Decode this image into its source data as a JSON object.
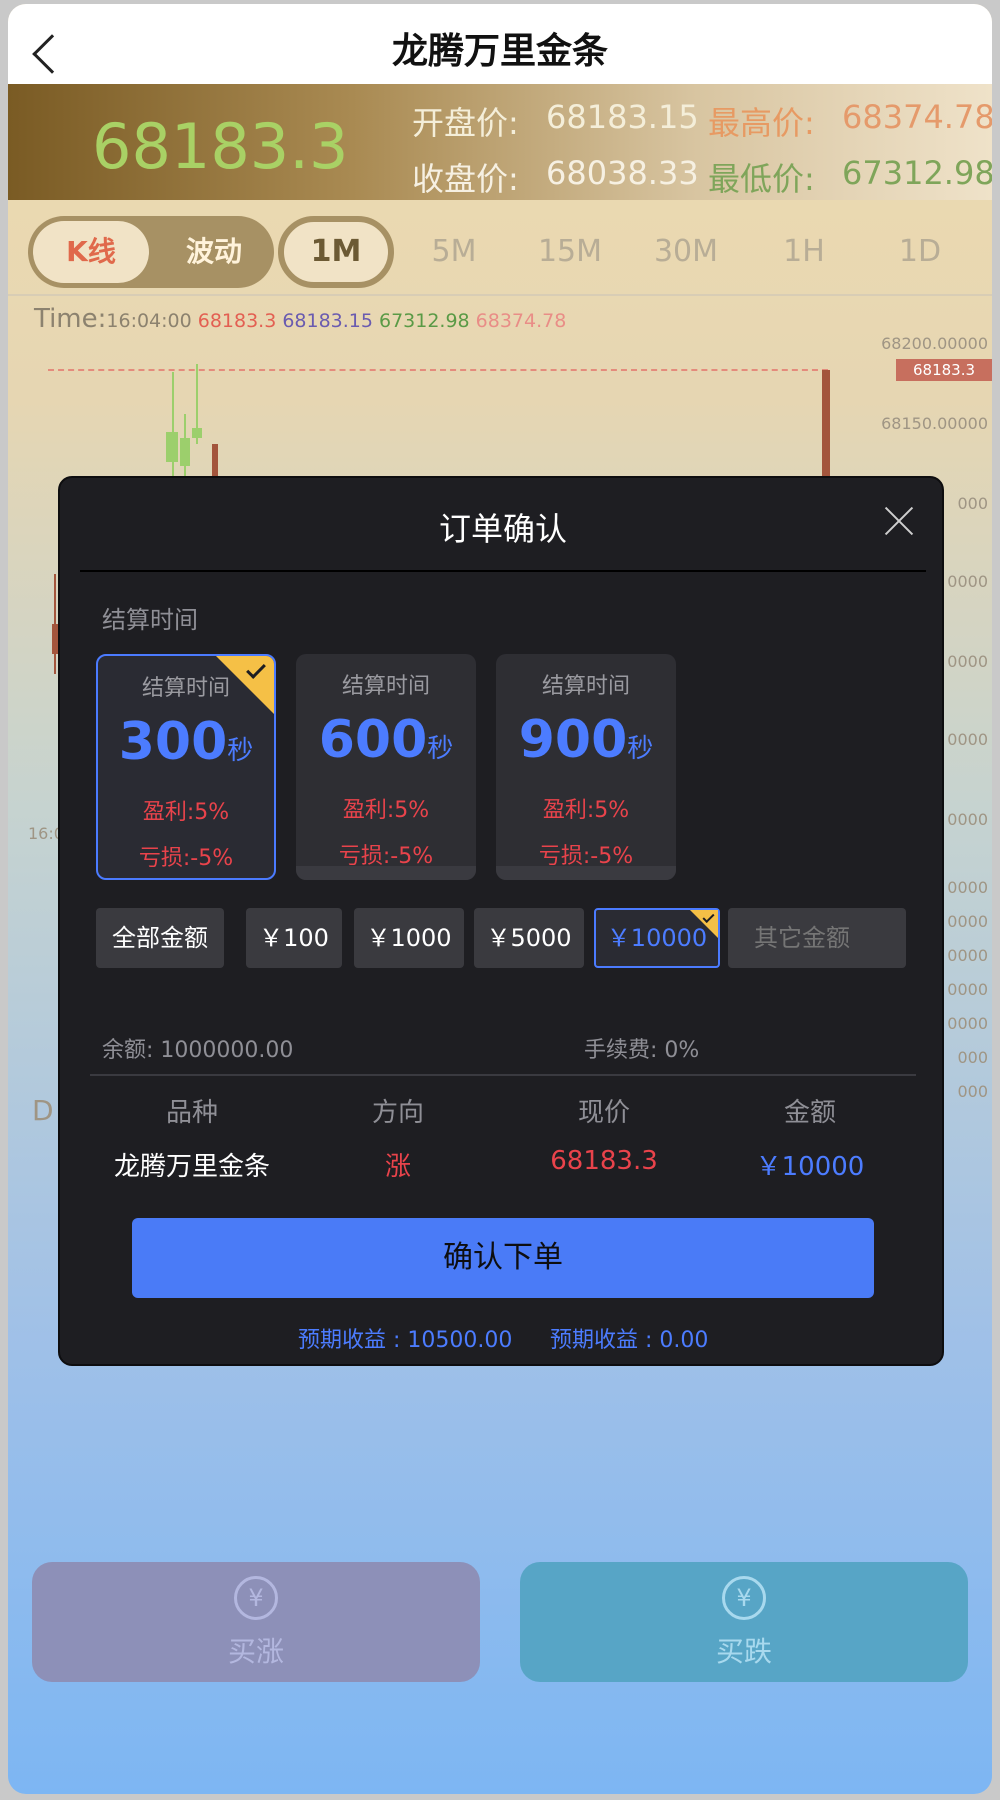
{
  "header": {
    "title": "龙腾万里金条"
  },
  "price_panel": {
    "current": "68183.3",
    "open_label": "开盘价:",
    "open_value": "68183.15",
    "high_label": "最高价:",
    "high_value": "68374.78",
    "close_label": "收盘价:",
    "close_value": "68038.33",
    "low_label": "最低价:",
    "low_value": "67312.98"
  },
  "tabs": {
    "kline": "K线",
    "wave": "波动",
    "timeframes": [
      "1M",
      "5M",
      "15M",
      "30M",
      "1H",
      "1D"
    ],
    "active_timeframe": "1M"
  },
  "chart_info": {
    "time_label": "Time:",
    "time_value": "16:04:00",
    "c": "68183.3",
    "o": "68183.15",
    "l": "67312.98",
    "h": "68374.78"
  },
  "chart_axis": {
    "y1": "68200.00000",
    "y2": "68150.00000",
    "last_price": "68183.3",
    "left_time": "16:0",
    "d_label": "D",
    "partial_labels": [
      "000",
      "0000",
      "0000",
      "0000",
      "0000",
      "0000",
      "0000",
      "0000",
      "0000",
      "0000",
      "000",
      "000",
      "0000",
      "0000"
    ]
  },
  "modal": {
    "title": "订单确认",
    "section_label": "结算时间",
    "cards": [
      {
        "head": "结算时间",
        "secs": "300",
        "unit": "秒",
        "profit": "盈利:5%",
        "loss": "亏损:-5%",
        "selected": true
      },
      {
        "head": "结算时间",
        "secs": "600",
        "unit": "秒",
        "profit": "盈利:5%",
        "loss": "亏损:-5%",
        "selected": false
      },
      {
        "head": "结算时间",
        "secs": "900",
        "unit": "秒",
        "profit": "盈利:5%",
        "loss": "亏损:-5%",
        "selected": false
      }
    ],
    "amounts": [
      "全部金额",
      "￥100",
      "￥1000",
      "￥5000",
      "￥10000"
    ],
    "selected_amount": "￥10000",
    "other_amount_placeholder": "其它金额",
    "balance": "余额: 1000000.00",
    "fee": "手续费: 0%",
    "table_headers": [
      "品种",
      "方向",
      "现价",
      "金额"
    ],
    "row": {
      "product": "龙腾万里金条",
      "direction": "涨",
      "price": "68183.3",
      "amount": "￥10000"
    },
    "confirm_label": "确认下单",
    "expected_profit": "预期收益 : 10500.00",
    "expected_loss": "预期收益 : 0.00"
  },
  "actions": {
    "buy_up": "买涨",
    "buy_down": "买跌"
  },
  "colors": {
    "accent_blue": "#4a7bf7",
    "rise_red": "#e9434b",
    "selected_yellow": "#f5c046"
  }
}
